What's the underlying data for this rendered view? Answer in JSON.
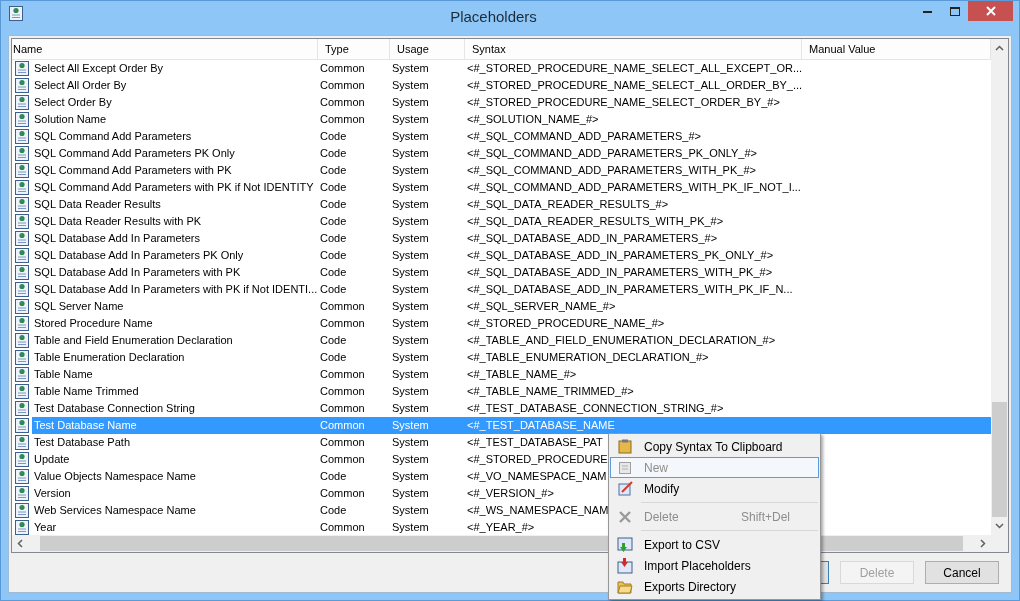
{
  "window": {
    "title": "Placeholders"
  },
  "table": {
    "columns": [
      "Name",
      "Type",
      "Usage",
      "Syntax",
      "Manual Value"
    ],
    "rows": [
      {
        "name": "Select All Except Order By",
        "type": "Common",
        "usage": "System",
        "syntax": "<#_STORED_PROCEDURE_NAME_SELECT_ALL_EXCEPT_OR...",
        "selected": false
      },
      {
        "name": "Select All Order By",
        "type": "Common",
        "usage": "System",
        "syntax": "<#_STORED_PROCEDURE_NAME_SELECT_ALL_ORDER_BY_...",
        "selected": false
      },
      {
        "name": "Select Order By",
        "type": "Common",
        "usage": "System",
        "syntax": "<#_STORED_PROCEDURE_NAME_SELECT_ORDER_BY_#>",
        "selected": false
      },
      {
        "name": "Solution Name",
        "type": "Common",
        "usage": "System",
        "syntax": "<#_SOLUTION_NAME_#>",
        "selected": false
      },
      {
        "name": "SQL Command Add Parameters",
        "type": "Code",
        "usage": "System",
        "syntax": "<#_SQL_COMMAND_ADD_PARAMETERS_#>",
        "selected": false
      },
      {
        "name": "SQL Command Add Parameters PK Only",
        "type": "Code",
        "usage": "System",
        "syntax": "<#_SQL_COMMAND_ADD_PARAMETERS_PK_ONLY_#>",
        "selected": false
      },
      {
        "name": "SQL Command Add Parameters with PK",
        "type": "Code",
        "usage": "System",
        "syntax": "<#_SQL_COMMAND_ADD_PARAMETERS_WITH_PK_#>",
        "selected": false
      },
      {
        "name": "SQL Command Add Parameters with PK if Not IDENTITY",
        "type": "Code",
        "usage": "System",
        "syntax": "<#_SQL_COMMAND_ADD_PARAMETERS_WITH_PK_IF_NOT_I...",
        "selected": false
      },
      {
        "name": "SQL Data Reader Results",
        "type": "Code",
        "usage": "System",
        "syntax": "<#_SQL_DATA_READER_RESULTS_#>",
        "selected": false
      },
      {
        "name": "SQL Data Reader Results with PK",
        "type": "Code",
        "usage": "System",
        "syntax": "<#_SQL_DATA_READER_RESULTS_WITH_PK_#>",
        "selected": false
      },
      {
        "name": "SQL Database Add In Parameters",
        "type": "Code",
        "usage": "System",
        "syntax": "<#_SQL_DATABASE_ADD_IN_PARAMETERS_#>",
        "selected": false
      },
      {
        "name": "SQL Database Add In Parameters PK Only",
        "type": "Code",
        "usage": "System",
        "syntax": "<#_SQL_DATABASE_ADD_IN_PARAMETERS_PK_ONLY_#>",
        "selected": false
      },
      {
        "name": "SQL Database Add In Parameters with PK",
        "type": "Code",
        "usage": "System",
        "syntax": "<#_SQL_DATABASE_ADD_IN_PARAMETERS_WITH_PK_#>",
        "selected": false
      },
      {
        "name": "SQL Database Add In Parameters with PK if Not IDENTI...",
        "type": "Code",
        "usage": "System",
        "syntax": "<#_SQL_DATABASE_ADD_IN_PARAMETERS_WITH_PK_IF_N...",
        "selected": false
      },
      {
        "name": "SQL Server Name",
        "type": "Common",
        "usage": "System",
        "syntax": "<#_SQL_SERVER_NAME_#>",
        "selected": false
      },
      {
        "name": "Stored Procedure Name",
        "type": "Common",
        "usage": "System",
        "syntax": "<#_STORED_PROCEDURE_NAME_#>",
        "selected": false
      },
      {
        "name": "Table and Field Enumeration Declaration",
        "type": "Code",
        "usage": "System",
        "syntax": "<#_TABLE_AND_FIELD_ENUMERATION_DECLARATION_#>",
        "selected": false
      },
      {
        "name": "Table Enumeration Declaration",
        "type": "Code",
        "usage": "System",
        "syntax": "<#_TABLE_ENUMERATION_DECLARATION_#>",
        "selected": false
      },
      {
        "name": "Table Name",
        "type": "Common",
        "usage": "System",
        "syntax": "<#_TABLE_NAME_#>",
        "selected": false
      },
      {
        "name": "Table Name Trimmed",
        "type": "Common",
        "usage": "System",
        "syntax": "<#_TABLE_NAME_TRIMMED_#>",
        "selected": false
      },
      {
        "name": "Test Database Connection String",
        "type": "Common",
        "usage": "System",
        "syntax": "<#_TEST_DATABASE_CONNECTION_STRING_#>",
        "selected": false
      },
      {
        "name": "Test Database Name",
        "type": "Common",
        "usage": "System",
        "syntax": "<#_TEST_DATABASE_NAME",
        "selected": true
      },
      {
        "name": "Test Database Path",
        "type": "Common",
        "usage": "System",
        "syntax": "<#_TEST_DATABASE_PAT",
        "selected": false
      },
      {
        "name": "Update",
        "type": "Common",
        "usage": "System",
        "syntax": "<#_STORED_PROCEDURE",
        "selected": false
      },
      {
        "name": "Value Objects Namespace Name",
        "type": "Code",
        "usage": "System",
        "syntax": "<#_VO_NAMESPACE_NAM",
        "selected": false
      },
      {
        "name": "Version",
        "type": "Common",
        "usage": "System",
        "syntax": "<#_VERSION_#>",
        "selected": false
      },
      {
        "name": "Web Services Namespace Name",
        "type": "Code",
        "usage": "System",
        "syntax": "<#_WS_NAMESPACE_NAM",
        "selected": false
      },
      {
        "name": "Year",
        "type": "Common",
        "usage": "System",
        "syntax": "<#_YEAR_#>",
        "selected": false
      }
    ]
  },
  "buttons": [
    {
      "kind": "covered",
      "focused": true
    },
    {
      "kind": "labeled",
      "label": "Delete",
      "focused": false,
      "disabled": true
    },
    {
      "kind": "labeled",
      "label": "Cancel",
      "focused": false,
      "disabled": false
    }
  ],
  "context_menu": {
    "items": [
      {
        "kind": "item",
        "label": "Copy Syntax To Clipboard",
        "disabled": false,
        "selected": false
      },
      {
        "kind": "item",
        "label": "New",
        "disabled": true,
        "selected": true
      },
      {
        "kind": "item",
        "label": "Modify",
        "disabled": false,
        "selected": false
      },
      {
        "kind": "separator"
      },
      {
        "kind": "item",
        "label": "Delete",
        "shortcut": "Shift+Del",
        "disabled": true,
        "selected": false
      },
      {
        "kind": "separator"
      },
      {
        "kind": "item",
        "label": "Export to CSV",
        "disabled": false,
        "selected": false
      },
      {
        "kind": "item",
        "label": "Import Placeholders",
        "disabled": false,
        "selected": false
      },
      {
        "kind": "item",
        "label": "Exports Directory",
        "disabled": false,
        "selected": false
      }
    ]
  }
}
